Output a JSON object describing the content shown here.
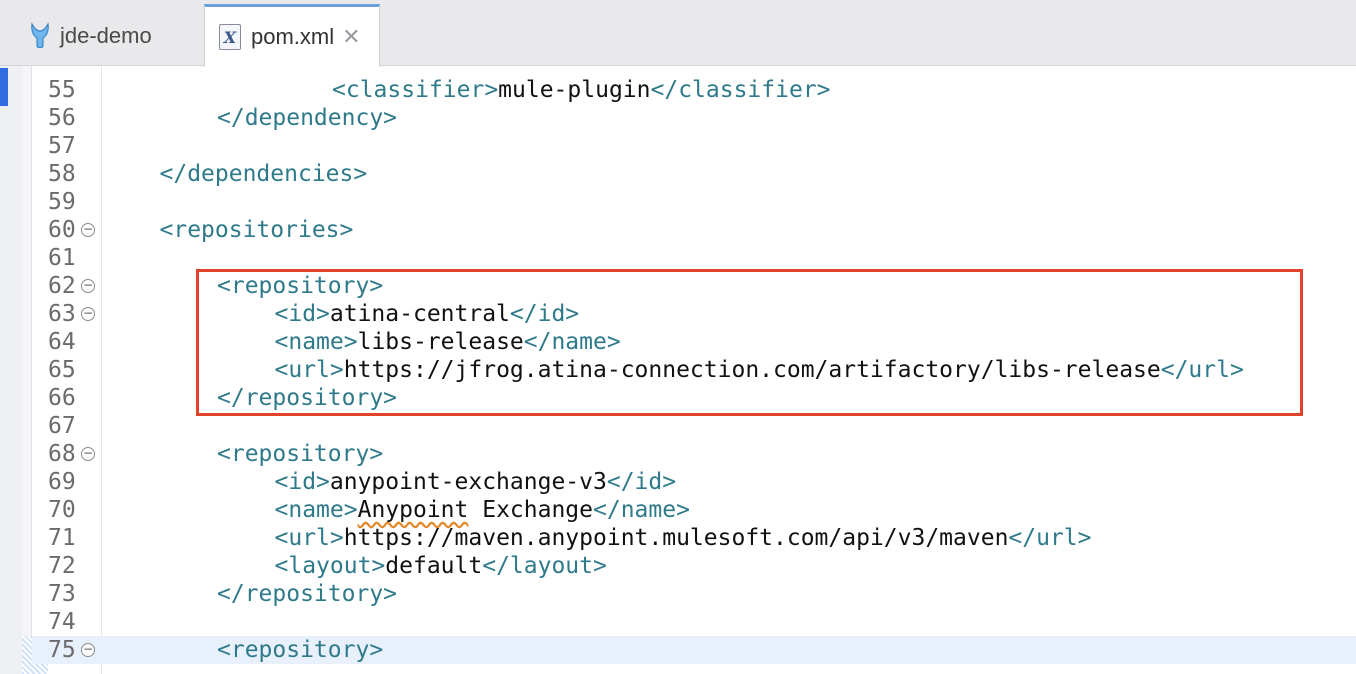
{
  "tabs": [
    {
      "label": "jde-demo",
      "active": false,
      "icon": "mule-icon"
    },
    {
      "label": "pom.xml",
      "active": true,
      "icon": "xml-file-icon",
      "close_glyph": "✕"
    }
  ],
  "editor": {
    "lines": [
      {
        "n": "55",
        "indent": 4,
        "open": "<classifier>",
        "text": "mule-plugin",
        "close": "</classifier>"
      },
      {
        "n": "56",
        "indent": 2,
        "open": "</dependency>"
      },
      {
        "n": "57",
        "indent": 0
      },
      {
        "n": "58",
        "indent": 1,
        "open": "</dependencies>"
      },
      {
        "n": "59",
        "indent": 0
      },
      {
        "n": "60",
        "indent": 1,
        "open": "<repositories>",
        "fold": true
      },
      {
        "n": "61",
        "indent": 0
      },
      {
        "n": "62",
        "indent": 2,
        "open": "<repository>",
        "fold": true
      },
      {
        "n": "63",
        "indent": 3,
        "open": "<id>",
        "text": "atina-central",
        "close": "</id>",
        "fold": true
      },
      {
        "n": "64",
        "indent": 3,
        "open": "<name>",
        "text": "libs-release",
        "close": "</name>"
      },
      {
        "n": "65",
        "indent": 3,
        "open": "<url>",
        "text": "https://jfrog.atina-connection.com/artifactory/libs-release",
        "close": "</url>"
      },
      {
        "n": "66",
        "indent": 2,
        "open": "</repository>"
      },
      {
        "n": "67",
        "indent": 0
      },
      {
        "n": "68",
        "indent": 2,
        "open": "<repository>",
        "fold": true
      },
      {
        "n": "69",
        "indent": 3,
        "open": "<id>",
        "text": "anypoint-exchange-v3",
        "close": "</id>"
      },
      {
        "n": "70",
        "indent": 3,
        "open": "<name>",
        "text": "Anypoint",
        "text2": " Exchange",
        "close": "</name>",
        "squiggle": true
      },
      {
        "n": "71",
        "indent": 3,
        "open": "<url>",
        "text": "https://maven.anypoint.mulesoft.com/api/v3/maven",
        "close": "</url>"
      },
      {
        "n": "72",
        "indent": 3,
        "open": "<layout>",
        "text": "default",
        "close": "</layout>"
      },
      {
        "n": "73",
        "indent": 2,
        "open": "</repository>"
      },
      {
        "n": "74",
        "indent": 0
      },
      {
        "n": "75",
        "indent": 2,
        "open": "<repository>",
        "fold": true,
        "current": true
      }
    ]
  },
  "colors": {
    "tag": "#2f7a8a",
    "highlight": "#e0432a",
    "current_line": "#e8f0fc"
  }
}
